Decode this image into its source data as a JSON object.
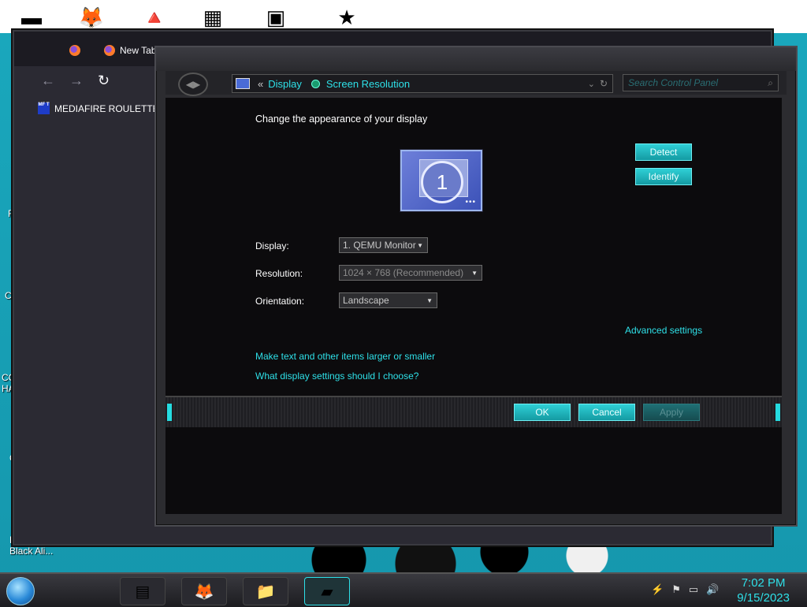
{
  "desktop": {
    "labels": [
      "R",
      "Co",
      "CO",
      "HA",
      "C",
      "L",
      "Black Ali..."
    ]
  },
  "firefox": {
    "tab_label": "New Tab",
    "bookmark_label": "MEDIAFIRE ROULETTER",
    "bookmark_icon_text": "MF T"
  },
  "control_panel": {
    "breadcrumb": [
      "Display",
      "Screen Resolution"
    ],
    "breadcrumb_prefix": "«",
    "search_placeholder": "Search Control Panel",
    "heading": "Change the appearance of your display",
    "monitor_number": "1",
    "detect_label": "Detect",
    "identify_label": "Identify",
    "display_label": "Display:",
    "display_value": "1. QEMU Monitor",
    "resolution_label": "Resolution:",
    "resolution_value": "1024 × 768 (Recommended)",
    "orientation_label": "Orientation:",
    "orientation_value": "Landscape",
    "advanced_link": "Advanced settings",
    "text_size_link": "Make text and other items larger or smaller",
    "help_link": "What display settings should I choose?",
    "ok_label": "OK",
    "cancel_label": "Cancel",
    "apply_label": "Apply"
  },
  "taskbar": {
    "time": "7:02 PM",
    "date": "9/15/2023"
  },
  "colors": {
    "accent": "#2ee0e8",
    "window_bg": "#0c0b0d"
  }
}
